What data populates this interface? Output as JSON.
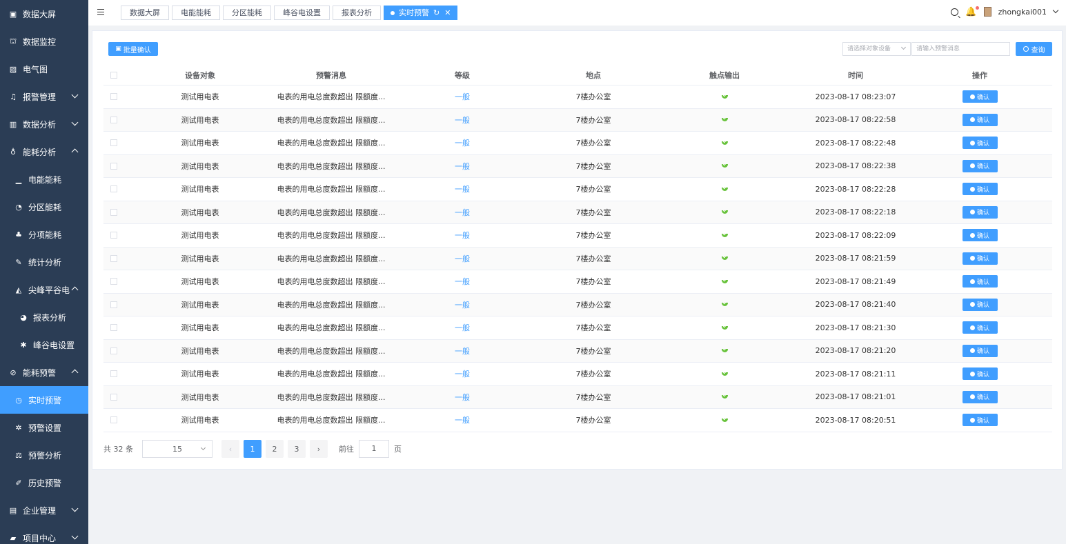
{
  "sidebar": {
    "items": [
      {
        "label": "数据大屏",
        "icon": "monitor-icon",
        "level": 0,
        "arrow": ""
      },
      {
        "label": "数据监控",
        "icon": "binoculars-icon",
        "level": 0,
        "arrow": ""
      },
      {
        "label": "电气图",
        "icon": "picture-icon",
        "level": 0,
        "arrow": ""
      },
      {
        "label": "报警管理",
        "icon": "bell-icon",
        "level": 0,
        "arrow": "down"
      },
      {
        "label": "数据分析",
        "icon": "bar-chart-icon",
        "level": 0,
        "arrow": "down"
      },
      {
        "label": "能耗分析",
        "icon": "bulb-icon",
        "level": 0,
        "arrow": "up"
      },
      {
        "label": "电能能耗",
        "icon": "signal-icon",
        "level": 1,
        "arrow": ""
      },
      {
        "label": "分区能耗",
        "icon": "pie-icon",
        "level": 1,
        "arrow": ""
      },
      {
        "label": "分项能耗",
        "icon": "org-icon",
        "level": 1,
        "arrow": ""
      },
      {
        "label": "统计分析",
        "icon": "brush-icon",
        "level": 1,
        "arrow": ""
      },
      {
        "label": "尖峰平谷电",
        "icon": "area-chart-icon",
        "level": 1,
        "arrow": "up"
      },
      {
        "label": "报表分析",
        "icon": "pie-chart-icon",
        "level": 2,
        "arrow": ""
      },
      {
        "label": "峰谷电设置",
        "icon": "gear-icon",
        "level": 2,
        "arrow": ""
      },
      {
        "label": "能耗预警",
        "icon": "compass-icon",
        "level": 0,
        "arrow": "up"
      },
      {
        "label": "实时预警",
        "icon": "alarm-clock-icon",
        "level": 1,
        "arrow": "",
        "active": true
      },
      {
        "label": "预警设置",
        "icon": "setting-icon",
        "level": 1,
        "arrow": ""
      },
      {
        "label": "预警分析",
        "icon": "scale-icon",
        "level": 1,
        "arrow": ""
      },
      {
        "label": "历史预警",
        "icon": "paperclip-icon",
        "level": 1,
        "arrow": ""
      },
      {
        "label": "企业管理",
        "icon": "building-icon",
        "level": 0,
        "arrow": "down"
      },
      {
        "label": "项目中心",
        "icon": "briefcase-icon",
        "level": 0,
        "arrow": "down"
      }
    ]
  },
  "tabs": [
    {
      "label": "数据大屏",
      "active": false
    },
    {
      "label": "电能能耗",
      "active": false
    },
    {
      "label": "分区能耗",
      "active": false
    },
    {
      "label": "峰谷电设置",
      "active": false
    },
    {
      "label": "报表分析",
      "active": false
    },
    {
      "label": "实时预警",
      "active": true
    }
  ],
  "user": {
    "name": "zhongkai001"
  },
  "toolbar": {
    "batch_label": "批量确认",
    "device_placeholder": "请选择对象设备",
    "message_placeholder": "请输入预警消息",
    "query_label": "查询"
  },
  "table": {
    "headers": [
      "设备对象",
      "预警消息",
      "等级",
      "地点",
      "触点输出",
      "时间",
      "操作"
    ],
    "action_label": "确认",
    "rows": [
      {
        "device": "测试用电表",
        "message": "电表的用电总度数超出 限额度...",
        "level": "一般",
        "location": "7楼办公室",
        "time": "2023-08-17 08:23:07"
      },
      {
        "device": "测试用电表",
        "message": "电表的用电总度数超出 限额度...",
        "level": "一般",
        "location": "7楼办公室",
        "time": "2023-08-17 08:22:58"
      },
      {
        "device": "测试用电表",
        "message": "电表的用电总度数超出 限额度...",
        "level": "一般",
        "location": "7楼办公室",
        "time": "2023-08-17 08:22:48"
      },
      {
        "device": "测试用电表",
        "message": "电表的用电总度数超出 限额度...",
        "level": "一般",
        "location": "7楼办公室",
        "time": "2023-08-17 08:22:38"
      },
      {
        "device": "测试用电表",
        "message": "电表的用电总度数超出 限额度...",
        "level": "一般",
        "location": "7楼办公室",
        "time": "2023-08-17 08:22:28"
      },
      {
        "device": "测试用电表",
        "message": "电表的用电总度数超出 限额度...",
        "level": "一般",
        "location": "7楼办公室",
        "time": "2023-08-17 08:22:18"
      },
      {
        "device": "测试用电表",
        "message": "电表的用电总度数超出 限额度...",
        "level": "一般",
        "location": "7楼办公室",
        "time": "2023-08-17 08:22:09"
      },
      {
        "device": "测试用电表",
        "message": "电表的用电总度数超出 限额度...",
        "level": "一般",
        "location": "7楼办公室",
        "time": "2023-08-17 08:21:59"
      },
      {
        "device": "测试用电表",
        "message": "电表的用电总度数超出 限额度...",
        "level": "一般",
        "location": "7楼办公室",
        "time": "2023-08-17 08:21:49"
      },
      {
        "device": "测试用电表",
        "message": "电表的用电总度数超出 限额度...",
        "level": "一般",
        "location": "7楼办公室",
        "time": "2023-08-17 08:21:40"
      },
      {
        "device": "测试用电表",
        "message": "电表的用电总度数超出 限额度...",
        "level": "一般",
        "location": "7楼办公室",
        "time": "2023-08-17 08:21:30"
      },
      {
        "device": "测试用电表",
        "message": "电表的用电总度数超出 限额度...",
        "level": "一般",
        "location": "7楼办公室",
        "time": "2023-08-17 08:21:20"
      },
      {
        "device": "测试用电表",
        "message": "电表的用电总度数超出 限额度...",
        "level": "一般",
        "location": "7楼办公室",
        "time": "2023-08-17 08:21:11"
      },
      {
        "device": "测试用电表",
        "message": "电表的用电总度数超出 限额度...",
        "level": "一般",
        "location": "7楼办公室",
        "time": "2023-08-17 08:21:01"
      },
      {
        "device": "测试用电表",
        "message": "电表的用电总度数超出 限额度...",
        "level": "一般",
        "location": "7楼办公室",
        "time": "2023-08-17 08:20:51"
      }
    ]
  },
  "pagination": {
    "total_label": "共 32 条",
    "page_size": "15",
    "pages": [
      "1",
      "2",
      "3"
    ],
    "current": "1",
    "goto_label": "前往",
    "goto_value": "1",
    "page_suffix": "页"
  },
  "colors": {
    "primary": "#409eff",
    "sidebar": "#2b3d55",
    "success": "#67c23a"
  }
}
